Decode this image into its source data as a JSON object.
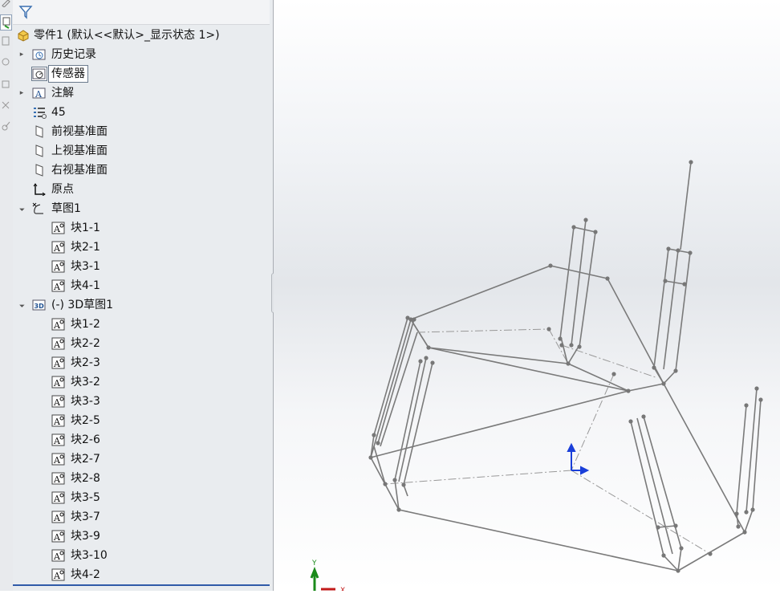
{
  "feature_tree": {
    "part": {
      "label": "零件1  (默认<<默认>_显示状态 1>)",
      "icon": "part-icon"
    },
    "items": [
      {
        "label": "历史记录",
        "icon": "history-icon",
        "indent": 1,
        "expandable": true,
        "expanded": false,
        "selected": false
      },
      {
        "label": "传感器",
        "icon": "sensor-icon",
        "indent": 1,
        "expandable": false,
        "expanded": false,
        "selected": true
      },
      {
        "label": "注解",
        "icon": "annotation-icon",
        "indent": 1,
        "expandable": true,
        "expanded": false,
        "selected": false
      },
      {
        "label": "45",
        "icon": "material-icon",
        "indent": 1,
        "expandable": false,
        "expanded": false,
        "selected": false
      },
      {
        "label": "前视基准面",
        "icon": "plane-icon",
        "indent": 1,
        "expandable": false,
        "expanded": false,
        "selected": false
      },
      {
        "label": "上视基准面",
        "icon": "plane-icon",
        "indent": 1,
        "expandable": false,
        "expanded": false,
        "selected": false
      },
      {
        "label": "右视基准面",
        "icon": "plane-icon",
        "indent": 1,
        "expandable": false,
        "expanded": false,
        "selected": false
      },
      {
        "label": "原点",
        "icon": "origin-icon",
        "indent": 1,
        "expandable": false,
        "expanded": false,
        "selected": false
      },
      {
        "label": "草图1",
        "icon": "sketch-icon",
        "indent": 1,
        "expandable": true,
        "expanded": true,
        "selected": false
      },
      {
        "label": "块1-1",
        "icon": "block-icon",
        "indent": 2,
        "expandable": false,
        "expanded": false,
        "selected": false
      },
      {
        "label": "块2-1",
        "icon": "block-icon",
        "indent": 2,
        "expandable": false,
        "expanded": false,
        "selected": false
      },
      {
        "label": "块3-1",
        "icon": "block-icon",
        "indent": 2,
        "expandable": false,
        "expanded": false,
        "selected": false
      },
      {
        "label": "块4-1",
        "icon": "block-icon",
        "indent": 2,
        "expandable": false,
        "expanded": false,
        "selected": false
      },
      {
        "label": "(-) 3D草图1",
        "icon": "3d-sketch-icon",
        "indent": 1,
        "expandable": true,
        "expanded": true,
        "selected": false
      },
      {
        "label": "块1-2",
        "icon": "block-icon",
        "indent": 2,
        "expandable": false,
        "expanded": false,
        "selected": false
      },
      {
        "label": "块2-2",
        "icon": "block-icon",
        "indent": 2,
        "expandable": false,
        "expanded": false,
        "selected": false
      },
      {
        "label": "块2-3",
        "icon": "block-icon",
        "indent": 2,
        "expandable": false,
        "expanded": false,
        "selected": false
      },
      {
        "label": "块3-2",
        "icon": "block-icon",
        "indent": 2,
        "expandable": false,
        "expanded": false,
        "selected": false
      },
      {
        "label": "块3-3",
        "icon": "block-icon",
        "indent": 2,
        "expandable": false,
        "expanded": false,
        "selected": false
      },
      {
        "label": "块2-5",
        "icon": "block-icon",
        "indent": 2,
        "expandable": false,
        "expanded": false,
        "selected": false
      },
      {
        "label": "块2-6",
        "icon": "block-icon",
        "indent": 2,
        "expandable": false,
        "expanded": false,
        "selected": false
      },
      {
        "label": "块2-7",
        "icon": "block-icon",
        "indent": 2,
        "expandable": false,
        "expanded": false,
        "selected": false
      },
      {
        "label": "块2-8",
        "icon": "block-icon",
        "indent": 2,
        "expandable": false,
        "expanded": false,
        "selected": false
      },
      {
        "label": "块3-5",
        "icon": "block-icon",
        "indent": 2,
        "expandable": false,
        "expanded": false,
        "selected": false
      },
      {
        "label": "块3-7",
        "icon": "block-icon",
        "indent": 2,
        "expandable": false,
        "expanded": false,
        "selected": false
      },
      {
        "label": "块3-9",
        "icon": "block-icon",
        "indent": 2,
        "expandable": false,
        "expanded": false,
        "selected": false
      },
      {
        "label": "块3-10",
        "icon": "block-icon",
        "indent": 2,
        "expandable": false,
        "expanded": false,
        "selected": false
      },
      {
        "label": "块4-2",
        "icon": "block-icon",
        "indent": 2,
        "expandable": false,
        "expanded": false,
        "selected": false
      }
    ]
  },
  "viewport": {
    "triad_labels": {
      "y": "Y",
      "x": "X"
    },
    "colors": {
      "wire": "#7a7a7a",
      "triad_y": "#1a8a1a",
      "triad_x": "#c21a1a",
      "origin": "#1a3fd9",
      "selection_line": "#2f5aa8"
    }
  },
  "icons": {
    "filter": "filter-icon",
    "collapse": "collapse-panel-icon"
  }
}
